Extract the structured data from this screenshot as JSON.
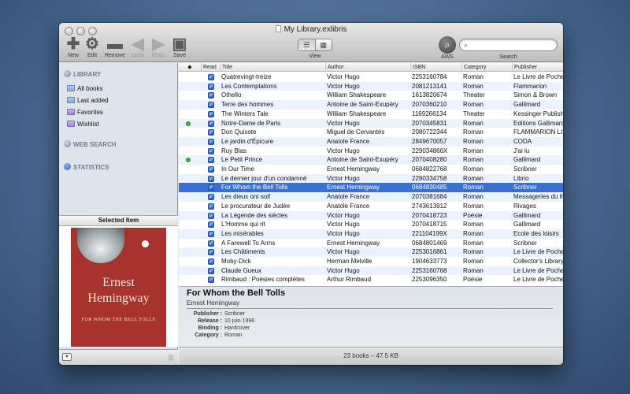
{
  "window": {
    "title": "My Library.exlibris"
  },
  "toolbar": {
    "new": "New",
    "edit": "Edit",
    "remove": "Remove",
    "undo": "Undo",
    "redo": "Redo",
    "save": "Save",
    "view": "View",
    "aws": "AWS",
    "search_label": "Search",
    "search_placeholder": ""
  },
  "icons": {
    "new": "plus-icon",
    "edit": "gear-icon",
    "remove": "minus-icon",
    "undo": "left-arrow-icon",
    "redo": "right-arrow-icon",
    "save": "floppy-disk-icon",
    "aws": "magnifier-icon"
  },
  "sidebar": {
    "library": "LIBRARY",
    "items": [
      {
        "label": "All books"
      },
      {
        "label": "Last added"
      },
      {
        "label": "Favorites"
      },
      {
        "label": "Wishlist"
      }
    ],
    "web_search": "WEB SEARCH",
    "statistics": "STATISTICS",
    "selected_header": "Selected Item"
  },
  "cover": {
    "author": "Ernest\nHemingway",
    "title": "FOR WHOM THE BELL TOLLS"
  },
  "table": {
    "columns": [
      "◆",
      "Read",
      "Title",
      "Author",
      "ISBN",
      "Category",
      "Publisher"
    ],
    "rows": [
      {
        "flag": false,
        "title": "Quatrevingt-treize",
        "author": "Victor Hugo",
        "isbn": "2253160784",
        "category": "Roman",
        "publisher": "Le Livre de Poche"
      },
      {
        "flag": false,
        "title": "Les Contemplations",
        "author": "Victor Hugo",
        "isbn": "2081213141",
        "category": "Roman",
        "publisher": "Flammarion"
      },
      {
        "flag": false,
        "title": "Othello",
        "author": "William Shakespeare",
        "isbn": "1613820674",
        "category": "Theater",
        "publisher": "Simon & Brown"
      },
      {
        "flag": false,
        "title": "Terre des hommes",
        "author": "Antoine de Saint-Exupéry",
        "isbn": "2070360210",
        "category": "Roman",
        "publisher": "Gallimard"
      },
      {
        "flag": false,
        "title": "The Winters Tale",
        "author": "William Shakespeare",
        "isbn": "1169266134",
        "category": "Theater",
        "publisher": "Kessinger Publishing"
      },
      {
        "flag": true,
        "title": "Notre-Dame de Paris",
        "author": "Victor Hugo",
        "isbn": "2070345831",
        "category": "Roman",
        "publisher": "Editions Gallimard"
      },
      {
        "flag": false,
        "title": "Don Quixote",
        "author": "Miguel de Cervantès",
        "isbn": "2080722344",
        "category": "Roman",
        "publisher": "FLAMMARION LIBRAIRIE"
      },
      {
        "flag": false,
        "title": "Le jardin d'Épicure",
        "author": "Anatole France",
        "isbn": "2849670057",
        "category": "Roman",
        "publisher": "CODA"
      },
      {
        "flag": false,
        "title": "Ruy Blas",
        "author": "Victor Hugo",
        "isbn": "229034866X",
        "category": "Roman",
        "publisher": "J'ai lu"
      },
      {
        "flag": true,
        "title": "Le Petit Prince",
        "author": "Antoine de Saint-Exupéry",
        "isbn": "2070408280",
        "category": "Roman",
        "publisher": "Gallimard"
      },
      {
        "flag": false,
        "title": "In Our Time",
        "author": "Ernest Hemingway",
        "isbn": "0684822768",
        "category": "Roman",
        "publisher": "Scribner"
      },
      {
        "flag": false,
        "title": "Le dernier jour d'un condamné",
        "author": "Victor Hugo",
        "isbn": "2290334758",
        "category": "Roman",
        "publisher": "Librio"
      },
      {
        "flag": false,
        "title": "For Whom the Bell Tolls",
        "author": "Ernest Hemingway",
        "isbn": "0684830485",
        "category": "Roman",
        "publisher": "Scribner",
        "selected": true
      },
      {
        "flag": false,
        "title": "Les dieux ont soif",
        "author": "Anatole France",
        "isbn": "2070381684",
        "category": "Roman",
        "publisher": "Messageries du livre"
      },
      {
        "flag": false,
        "title": "Le procurateur de Judée",
        "author": "Anatole France",
        "isbn": "2743613912",
        "category": "Roman",
        "publisher": "Rivages"
      },
      {
        "flag": false,
        "title": "La Légende des siècles",
        "author": "Victor Hugo",
        "isbn": "2070418723",
        "category": "Poésie",
        "publisher": "Gallimard"
      },
      {
        "flag": false,
        "title": "L'Homme qui rit",
        "author": "Victor Hugo",
        "isbn": "2070418715",
        "category": "Roman",
        "publisher": "Gallimard"
      },
      {
        "flag": false,
        "title": "Les misérables",
        "author": "Victor Hugo",
        "isbn": "221104199X",
        "category": "Roman",
        "publisher": "Ecole des loisirs"
      },
      {
        "flag": false,
        "title": "A Farewell To Arms",
        "author": "Ernest Hemingway",
        "isbn": "0684801469",
        "category": "Roman",
        "publisher": "Scribner"
      },
      {
        "flag": false,
        "title": "Les Châtiments",
        "author": "Victor Hugo",
        "isbn": "2253016861",
        "category": "Roman",
        "publisher": "Le Livre de Poche"
      },
      {
        "flag": false,
        "title": "Moby-Dick",
        "author": "Herman Melville",
        "isbn": "1904633773",
        "category": "Roman",
        "publisher": "Collector's Library"
      },
      {
        "flag": false,
        "title": "Claude Gueux",
        "author": "Victor Hugo",
        "isbn": "2253160768",
        "category": "Roman",
        "publisher": "Le Livre de Poche"
      },
      {
        "flag": false,
        "title": "Rimbaud : Poésies complètes",
        "author": "Arthur Rimbaud",
        "isbn": "2253096350",
        "category": "Poésie",
        "publisher": "Le Livre de Poche"
      }
    ]
  },
  "detail": {
    "title": "For Whom the Bell Tolls",
    "author": "Ernest Hemingway",
    "fields": [
      {
        "key": "Publisher :",
        "value": "Scribner"
      },
      {
        "key": "Release :",
        "value": "10 juin 1996"
      },
      {
        "key": "Binding :",
        "value": "Hardcover"
      },
      {
        "key": "Category :",
        "value": "Roman"
      }
    ]
  },
  "status": "23 books – 47.5 KB",
  "colors": {
    "selection": "#3b6fd2",
    "alt_row": "#edf3fe",
    "cover": "#a8322d"
  }
}
